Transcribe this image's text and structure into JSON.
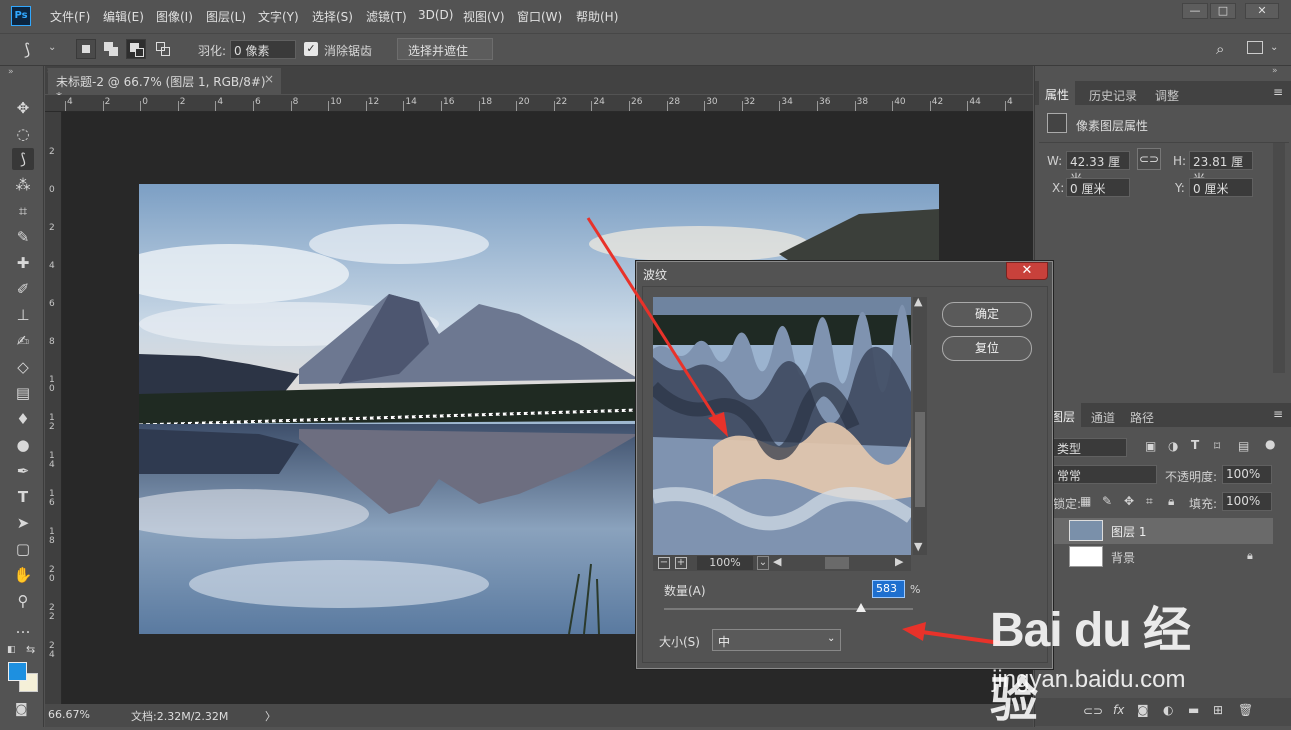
{
  "app": {
    "logo": "Ps"
  },
  "menu": [
    "文件(F)",
    "编辑(E)",
    "图像(I)",
    "图层(L)",
    "文字(Y)",
    "选择(S)",
    "滤镜(T)",
    "3D(D)",
    "视图(V)",
    "窗口(W)",
    "帮助(H)"
  ],
  "window_controls": {
    "minimize": "—",
    "restore": "□",
    "close": "✕"
  },
  "options": {
    "feather_label": "羽化:",
    "feather_value": "0 像素",
    "antialias_label": "消除锯齿",
    "select_mask_button": "选择并遮住 ..."
  },
  "document": {
    "tab_title": "未标题-2 @ 66.7% (图层 1, RGB/8#) *",
    "tab_close": "×"
  },
  "rulers": {
    "h_ticks": [
      "4",
      "2",
      "0",
      "2",
      "4",
      "6",
      "8",
      "10",
      "12",
      "14",
      "16",
      "18",
      "20",
      "22",
      "24",
      "26",
      "28",
      "30",
      "32",
      "34",
      "36",
      "38",
      "40",
      "42",
      "44",
      "4"
    ],
    "v_ticks": [
      "2",
      "0",
      "2",
      "4",
      "6",
      "8",
      "1\n0",
      "1\n2",
      "1\n4",
      "1\n6",
      "1\n8",
      "2\n0",
      "2\n2",
      "2\n4"
    ]
  },
  "status": {
    "zoom": "66.67%",
    "doc_info": "文档:2.32M/2.32M",
    "arrow": "〉"
  },
  "properties_panel": {
    "tabs": [
      "属性",
      "历史记录",
      "调整"
    ],
    "title": "像素图层属性",
    "w_label": "W:",
    "w_value": "42.33 厘米",
    "h_label": "H:",
    "h_value": "23.81 厘米",
    "x_label": "X:",
    "x_value": "0 厘米",
    "y_label": "Y:",
    "y_value": "0 厘米"
  },
  "layers_panel": {
    "tabs": [
      "图层",
      "通道",
      "路径"
    ],
    "kind_filter": "类型",
    "blend_mode": "常常",
    "opacity_label": "不透明度:",
    "opacity_value": "100%",
    "lock_label": "锁定:",
    "fill_label": "填充:",
    "fill_value": "100%",
    "layers": [
      {
        "name": "图层 1"
      },
      {
        "name": "背景"
      }
    ]
  },
  "dialog": {
    "title": "波纹",
    "ok_button": "确定",
    "reset_button": "复位",
    "zoom_value": "100%",
    "amount_label": "数量(A)",
    "amount_value": "583",
    "amount_unit": "%",
    "amount_slider_fraction": 0.79,
    "size_label": "大小(S)",
    "size_value": "中"
  },
  "watermark": {
    "brand": "Bai du 经验",
    "url": "jingyan.baidu.com"
  },
  "colors": {
    "accent": "#31a8ff",
    "foreground": "#1e90e0",
    "background": "#f5f0d8",
    "annotation_arrow": "#e8322a"
  }
}
